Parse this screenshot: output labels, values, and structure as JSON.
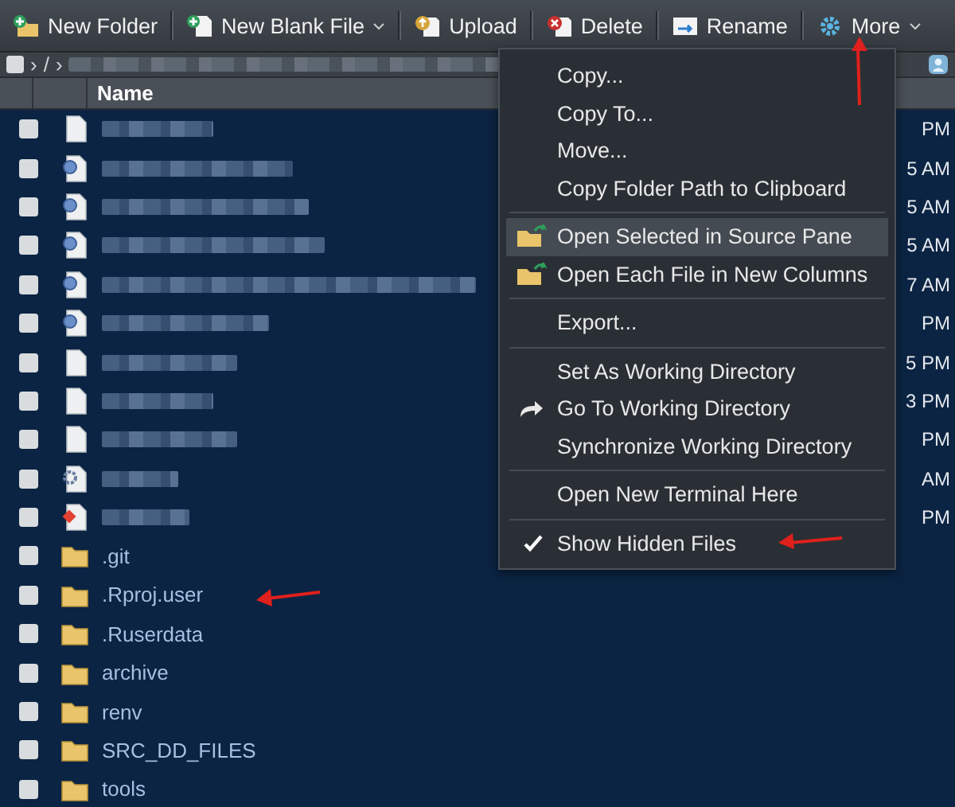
{
  "toolbar": [
    {
      "label": "New Folder",
      "kind": "new-folder",
      "dropdown": false
    },
    {
      "label": "New Blank File",
      "kind": "new-file",
      "dropdown": true
    },
    {
      "label": "Upload",
      "kind": "upload",
      "dropdown": false
    },
    {
      "label": "Delete",
      "kind": "delete",
      "dropdown": false
    },
    {
      "label": "Rename",
      "kind": "rename",
      "dropdown": false
    },
    {
      "label": "More",
      "kind": "more",
      "dropdown": true
    }
  ],
  "breadcrumb": {
    "select_all_checked": false,
    "separators": [
      "›",
      "/",
      "›"
    ]
  },
  "table": {
    "columns": [
      "Name"
    ],
    "rows": [
      {
        "kind": "document",
        "checked": false,
        "modified": "PM"
      },
      {
        "kind": "r-document",
        "checked": false,
        "modified": "5 AM"
      },
      {
        "kind": "r-document",
        "checked": false,
        "modified": "5 AM"
      },
      {
        "kind": "r-document",
        "checked": false,
        "modified": "5 AM"
      },
      {
        "kind": "r-document",
        "checked": false,
        "modified": "7 AM"
      },
      {
        "kind": "r-document",
        "checked": false,
        "modified": "PM"
      },
      {
        "kind": "document",
        "checked": false,
        "modified": "5 PM"
      },
      {
        "kind": "document",
        "checked": false,
        "modified": "3 PM"
      },
      {
        "kind": "document",
        "checked": false,
        "modified": "PM"
      },
      {
        "kind": "settings-document",
        "checked": false,
        "modified": "AM"
      },
      {
        "kind": "git-document",
        "checked": false,
        "modified": "PM"
      },
      {
        "kind": "folder",
        "checked": false,
        "name": ".git"
      },
      {
        "kind": "folder",
        "checked": false,
        "name": ".Rproj.user"
      },
      {
        "kind": "folder",
        "checked": false,
        "name": ".Ruserdata"
      },
      {
        "kind": "folder",
        "checked": false,
        "name": "archive"
      },
      {
        "kind": "folder",
        "checked": false,
        "name": "renv"
      },
      {
        "kind": "folder",
        "checked": false,
        "name": "SRC_DD_FILES"
      },
      {
        "kind": "folder",
        "checked": false,
        "name": "tools"
      }
    ]
  },
  "menu": {
    "items": [
      {
        "kind": "item",
        "label": "Copy...",
        "selected": false,
        "checked": false
      },
      {
        "kind": "item",
        "label": "Copy To...",
        "selected": false,
        "checked": false
      },
      {
        "kind": "item",
        "label": "Move...",
        "selected": false,
        "checked": false
      },
      {
        "kind": "item",
        "label": "Copy Folder Path to Clipboard",
        "selected": false,
        "checked": false
      },
      {
        "kind": "separator"
      },
      {
        "kind": "folder-item",
        "label": "Open Selected in Source Pane",
        "selected": true,
        "checked": false
      },
      {
        "kind": "folder-item",
        "label": "Open Each File in New Columns",
        "selected": false,
        "checked": false
      },
      {
        "kind": "separator"
      },
      {
        "kind": "item",
        "label": "Export...",
        "selected": false,
        "checked": false
      },
      {
        "kind": "separator"
      },
      {
        "kind": "item",
        "label": "Set As Working Directory",
        "selected": false,
        "checked": false
      },
      {
        "kind": "arrow-item",
        "label": "Go To Working Directory",
        "selected": false,
        "checked": false
      },
      {
        "kind": "item",
        "label": "Synchronize Working Directory",
        "selected": false,
        "checked": false
      },
      {
        "kind": "separator"
      },
      {
        "kind": "item",
        "label": "Open New Terminal Here",
        "selected": false,
        "checked": false
      },
      {
        "kind": "separator"
      },
      {
        "kind": "item",
        "label": "Show Hidden Files",
        "selected": false,
        "checked": true
      }
    ]
  }
}
